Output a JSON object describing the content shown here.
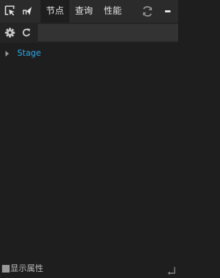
{
  "toolbar": {
    "select_tool_icon": "cursor-select-icon",
    "inspect_tool_icon": "send-pointer-icon",
    "refresh_icon": "refresh-icon",
    "minimize_icon": "minimize-icon"
  },
  "tabs": [
    {
      "label": "节点",
      "active": true
    },
    {
      "label": "查询",
      "active": false
    },
    {
      "label": "性能",
      "active": false
    }
  ],
  "filterbar": {
    "settings_icon": "gear-icon",
    "reload_icon": "reload-icon",
    "search_value": "",
    "search_placeholder": ""
  },
  "tree": {
    "nodes": [
      {
        "label": "Stage",
        "expanded": false
      }
    ]
  },
  "footer": {
    "show_properties_label": "显示属性",
    "show_properties_checked": false,
    "resize_icon": "resize-corner-icon"
  },
  "colors": {
    "background": "#1e1e1e",
    "topbar": "#2b2b2b",
    "node_text": "#2aa7e6",
    "input_bg": "#333333"
  }
}
